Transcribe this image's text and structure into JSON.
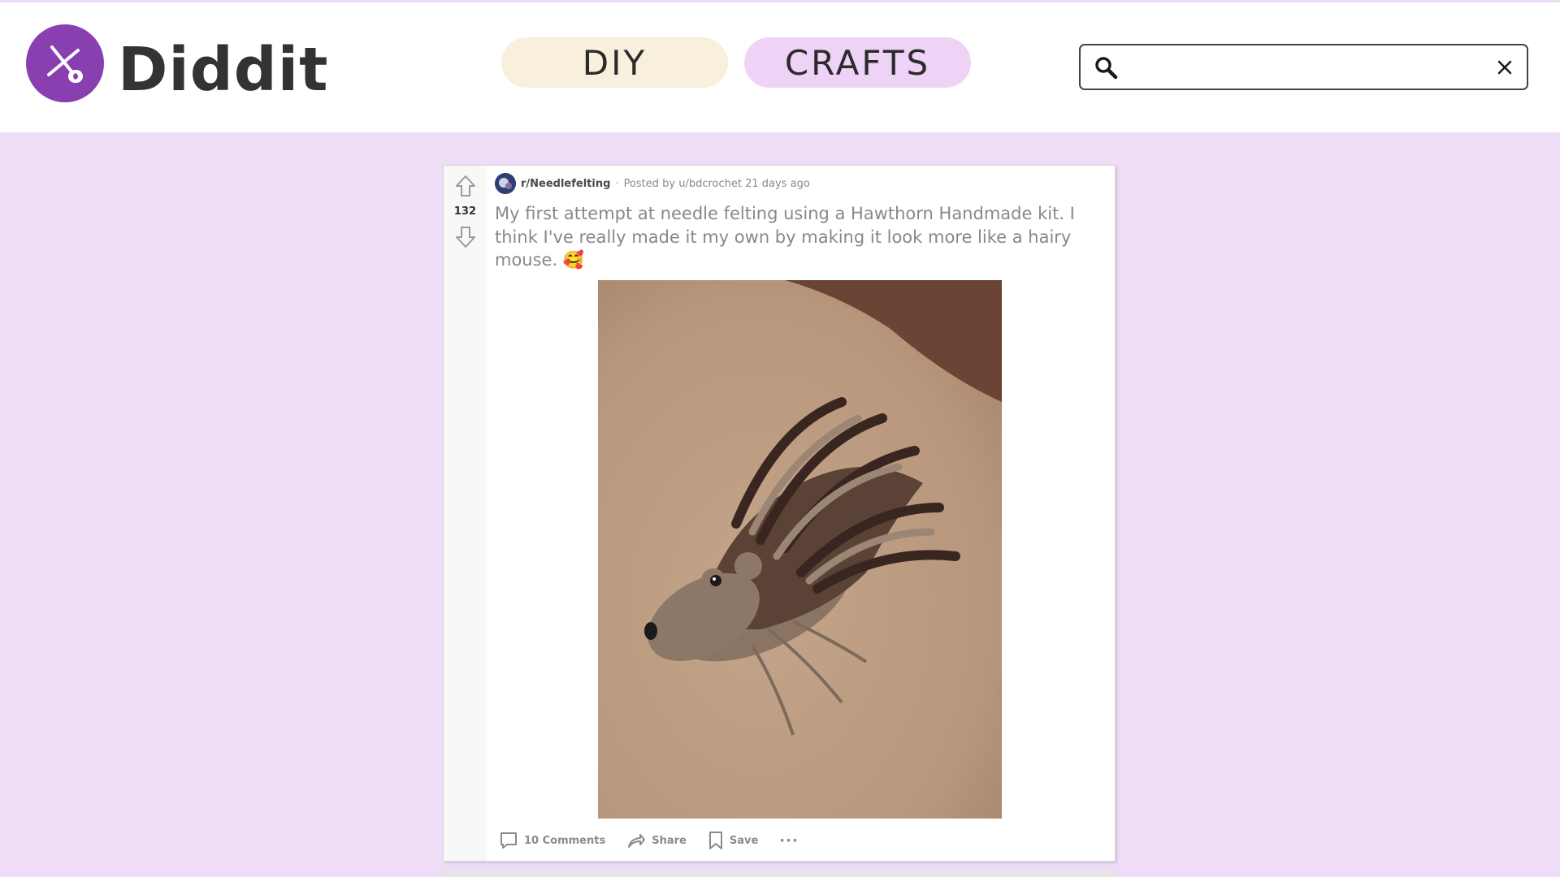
{
  "app": {
    "brand_name": "Diddit",
    "logo_icon": "scissors-icon",
    "accent_color": "#8a3fb0",
    "background_color": "#efdcf7"
  },
  "nav": {
    "tabs": [
      {
        "label": "DIY",
        "color": "#f8f0dc"
      },
      {
        "label": "CRAFTS",
        "color": "#efd3f6"
      }
    ]
  },
  "search": {
    "value": "",
    "placeholder": "",
    "icon": "search-icon",
    "clear_icon": "close-icon"
  },
  "post": {
    "subreddit": "r/Needlefelting",
    "separator": "·",
    "posted_by": "Posted by u/bdcrochet 21 days ago",
    "vote_count": "132",
    "title": "My first attempt at needle felting using a Hawthorn Handmade kit. I think I've really made it my own by making it look more like a hairy mouse. 🥰",
    "image_subject": "needle-felted hedgehog on carpet",
    "actions": {
      "comments": "10 Comments",
      "share": "Share",
      "save": "Save",
      "more": "···"
    }
  }
}
